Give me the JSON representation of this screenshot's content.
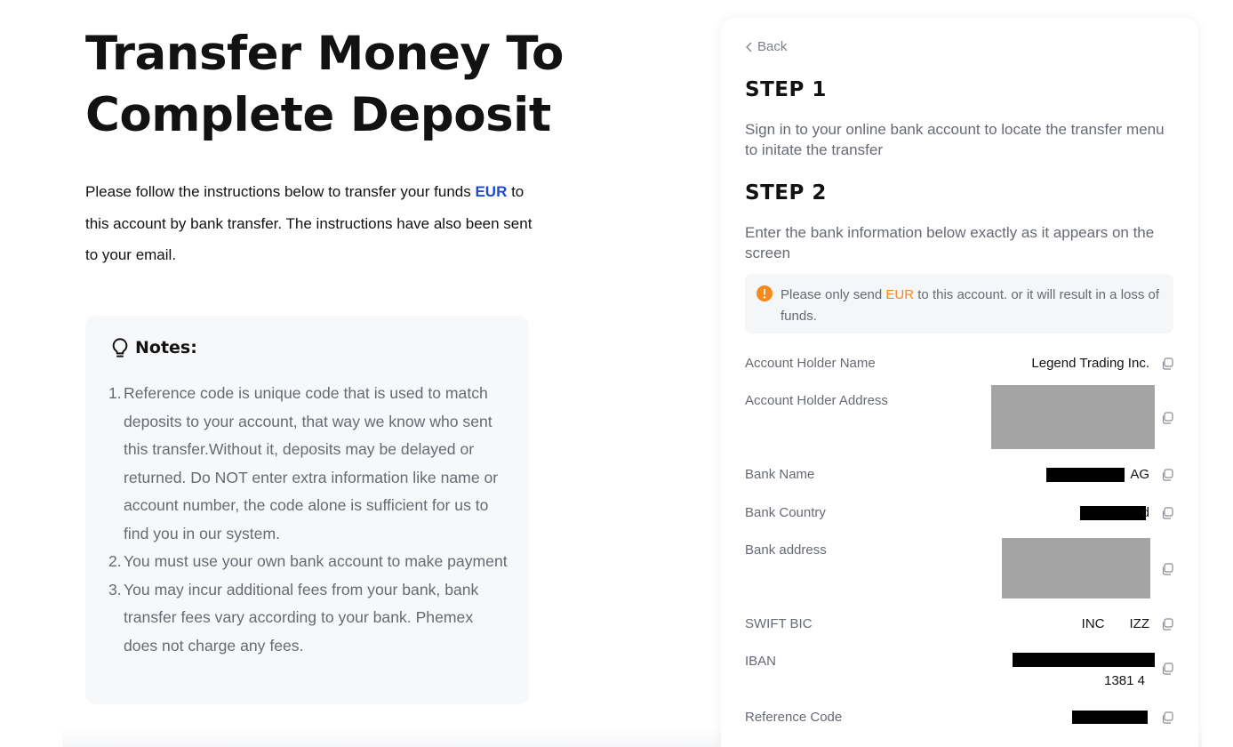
{
  "header": {
    "title": "Transfer Money To Complete Deposit"
  },
  "intro": {
    "before": "Please follow the instructions below to transfer your funds ",
    "currency": "EUR",
    "after": " to this account by bank transfer. The instructions have also been sent to your email."
  },
  "notes": {
    "title": "Notes:",
    "icon": "lightbulb-icon",
    "items": [
      {
        "num": "1.",
        "text": "Reference code is unique code that is used to match deposits to your account, that way we know who sent this transfer.Without it, deposits may be delayed or returned. Do NOT enter extra information like name or account number, the code alone is sufficient for us to find you in our system."
      },
      {
        "num": "2.",
        "text": "You must use your own bank account to make payment"
      },
      {
        "num": "3.",
        "text": "You may incur additional fees from your bank, bank transfer fees vary according to your bank. Phemex does not charge any fees."
      }
    ]
  },
  "panel": {
    "back_label": "Back",
    "step1": {
      "title": "STEP 1",
      "text": "Sign in to your online bank account to locate the transfer menu to initate the transfer"
    },
    "step2": {
      "title": "STEP 2",
      "text": "Enter the bank information below exactly as it appears on the screen"
    },
    "warning": {
      "icon": "warning-icon",
      "before": "Please only send ",
      "currency": "EUR",
      "after": " to this account. or it will result in a loss of funds."
    },
    "fields": [
      {
        "label": "Account Holder Name",
        "value": "Legend Trading Inc."
      },
      {
        "label": "Account Holder Address",
        "value": ""
      },
      {
        "label": "Bank Name",
        "value": "AG"
      },
      {
        "label": "Bank Country",
        "value": "d"
      },
      {
        "label": "Bank address",
        "value": ""
      },
      {
        "label": "SWIFT BIC",
        "value_a": "INC",
        "value_b": "IZZ"
      },
      {
        "label": "IBAN",
        "value": "1381 4"
      },
      {
        "label": "Reference Code",
        "value": ""
      }
    ]
  },
  "colors": {
    "accent_blue": "#1b4bd8",
    "warning_orange": "#f7881e"
  }
}
